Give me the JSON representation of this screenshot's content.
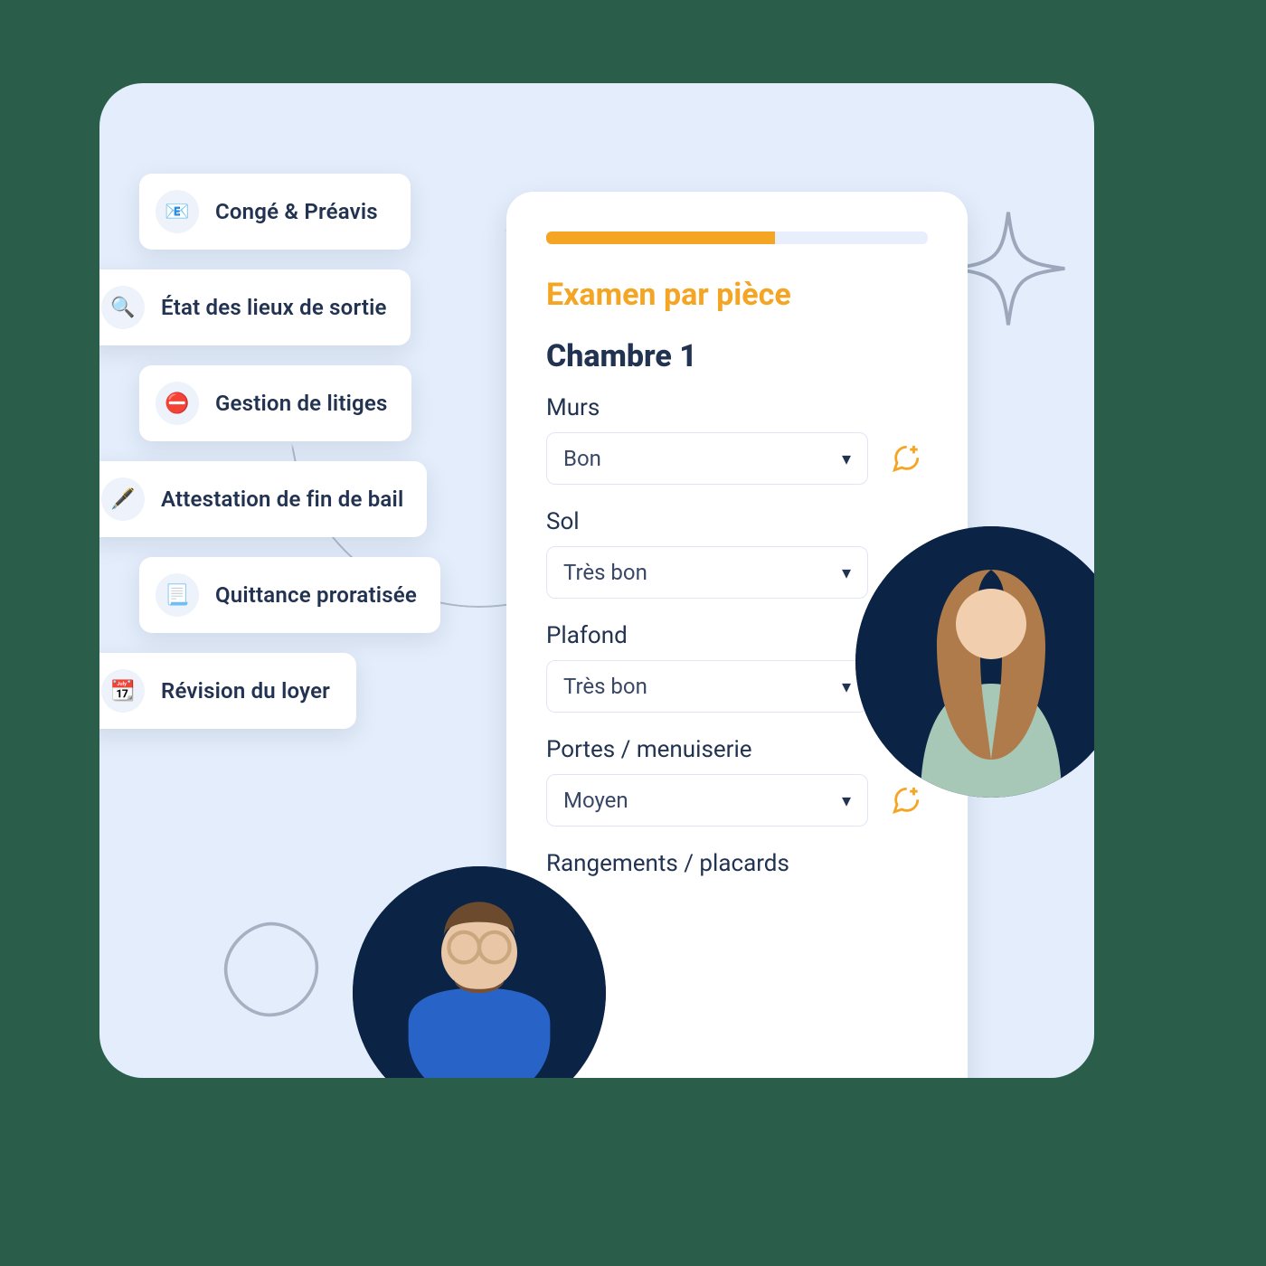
{
  "sidebar": {
    "items": [
      {
        "icon": "document-icon",
        "glyph": "📧",
        "label": "Congé & Préavis"
      },
      {
        "icon": "search-icon",
        "glyph": "🔍",
        "label": "État des lieux de sortie"
      },
      {
        "icon": "stop-icon",
        "glyph": "⛔",
        "label": "Gestion de litiges"
      },
      {
        "icon": "pen-icon",
        "glyph": "🖋️",
        "label": "Attestation de fin de bail"
      },
      {
        "icon": "receipt-icon",
        "glyph": "📃",
        "label": "Quittance proratisée"
      },
      {
        "icon": "calendar-icon",
        "glyph": "📆",
        "label": "Révision du loyer"
      }
    ]
  },
  "form": {
    "progress_percent": 60,
    "heading": "Examen par pièce",
    "room": "Chambre 1",
    "fields": [
      {
        "label": "Murs",
        "value": "Bon"
      },
      {
        "label": "Sol",
        "value": "Très bon"
      },
      {
        "label": "Plafond",
        "value": "Très bon"
      },
      {
        "label": "Portes / menuiserie",
        "value": "Moyen"
      },
      {
        "label": "Rangements / placards",
        "value": ""
      }
    ]
  },
  "colors": {
    "accent": "#f5a524",
    "text": "#223251",
    "panel_bg": "#e3edfb",
    "page_bg": "#2a5e4a"
  }
}
